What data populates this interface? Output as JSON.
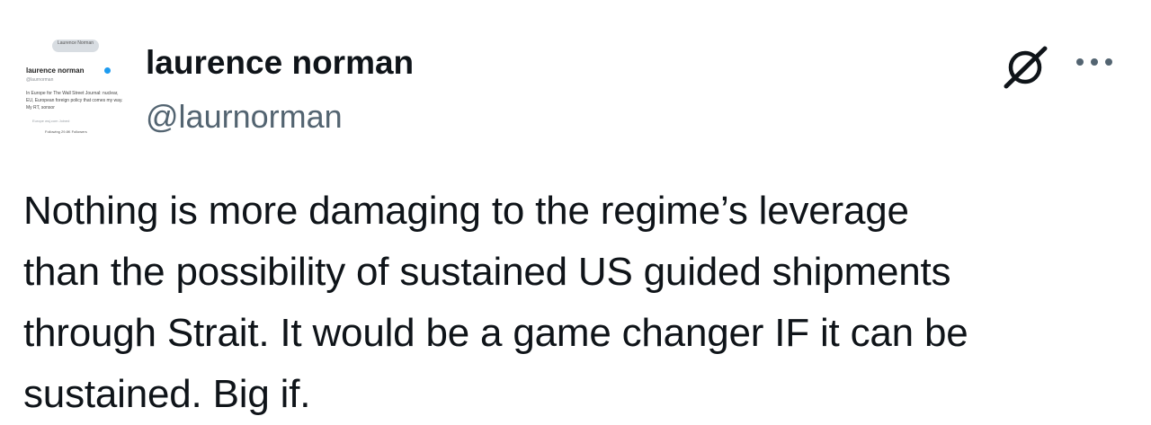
{
  "author": {
    "display_name": "laurence norman",
    "handle": "@laurnorman"
  },
  "avatar_image": {
    "banner_text": "Laurence Norman",
    "name": "laurence norman",
    "handle": "@laurnorman",
    "bio": "In Europe for The Wall Street Journal: nuclear, EU, European foreign policy that comes my way. My RT, sonsor",
    "meta": "Europe   wsj.com   Joined",
    "follow": "Following  29.8K Followers"
  },
  "icons": {
    "grok": "grok-icon",
    "more": "more-horizontal-icon"
  },
  "tweet": {
    "lines": [
      "Nothing is more damaging to the regime’s leverage",
      "than the possibility of sustained US guided shipments",
      "through Strait. It would be a game changer IF it can be",
      "sustained. Big if."
    ]
  },
  "colors": {
    "text": "#0f1419",
    "secondary": "#536471",
    "verified": "#1d9bf0"
  }
}
